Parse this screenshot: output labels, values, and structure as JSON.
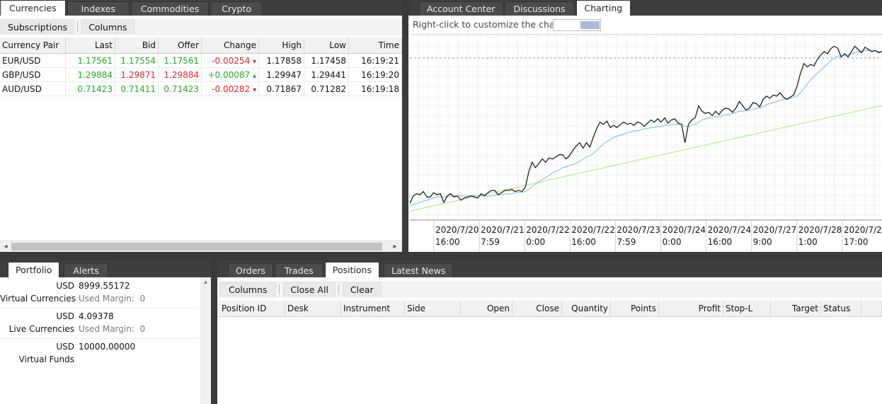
{
  "left_tabs": [
    "Currencies",
    "Indexes",
    "Commodities",
    "Crypto"
  ],
  "left_toolbar": {
    "subscriptions": "Subscriptions",
    "columns": "Columns"
  },
  "quotes": {
    "headers": [
      "Currency Pair",
      "Last",
      "Bid",
      "Offer",
      "Change",
      "High",
      "Low",
      "Time"
    ],
    "rows": [
      {
        "pair": "EUR/USD",
        "last": "1.17561",
        "bid": "1.17554",
        "offer": "1.17561",
        "change": "-0.00254",
        "dir": "▾",
        "high": "1.17858",
        "low": "1.17458",
        "time": "16:19:21"
      },
      {
        "pair": "GBP/USD",
        "last": "1.29884",
        "bid": "1.29871",
        "offer": "1.29884",
        "change": "+0.00087",
        "dir": "▴",
        "high": "1.29947",
        "low": "1.29441",
        "time": "16:19:20"
      },
      {
        "pair": "AUD/USD",
        "last": "0.71423",
        "bid": "0.71411",
        "offer": "0.71423",
        "change": "-0.00282",
        "dir": "▾",
        "high": "0.71867",
        "low": "0.71282",
        "time": "16:19:18"
      }
    ]
  },
  "right_tabs": [
    "Account Center",
    "Discussions",
    "Charting"
  ],
  "chart_hint": "Right-click to customize the chart",
  "chart_data": {
    "type": "line",
    "x_ticks": [
      {
        "date": "2020/7/20",
        "time": "16:00"
      },
      {
        "date": "2020/7/21",
        "time": "7:59"
      },
      {
        "date": "2020/7/22",
        "time": "0:00"
      },
      {
        "date": "2020/7/22",
        "time": "16:00"
      },
      {
        "date": "2020/7/23",
        "time": "7:59"
      },
      {
        "date": "2020/7/24",
        "time": "0:00"
      },
      {
        "date": "2020/7/24",
        "time": "16:00"
      },
      {
        "date": "2020/7/27",
        "time": "9:00"
      },
      {
        "date": "2020/7/28",
        "time": "1:00"
      },
      {
        "date": "2020/7/28",
        "time": "17:00"
      }
    ],
    "series": [
      {
        "color": "#111111",
        "values": [
          0.07,
          0.14,
          0.16,
          0.15,
          0.18,
          0.13,
          0.13,
          0.17,
          0.15,
          0.16,
          0.08,
          0.14,
          0.16,
          0.13,
          0.14,
          0.1,
          0.12,
          0.13,
          0.14,
          0.13,
          0.12,
          0.16,
          0.14,
          0.17,
          0.19,
          0.19,
          0.15,
          0.17,
          0.19,
          0.19,
          0.2,
          0.18,
          0.19,
          0.18,
          0.22,
          0.36,
          0.45,
          0.4,
          0.44,
          0.48,
          0.45,
          0.49,
          0.48,
          0.5,
          0.52,
          0.52,
          0.48,
          0.51,
          0.56,
          0.6,
          0.63,
          0.58,
          0.63,
          0.59,
          0.68,
          0.76,
          0.82,
          0.8,
          0.83,
          0.77,
          0.79,
          0.77,
          0.8,
          0.82,
          0.8,
          0.81,
          0.79,
          0.82,
          0.81,
          0.78,
          0.81,
          0.84,
          0.82,
          0.85,
          0.82,
          0.86,
          0.81,
          0.84,
          0.85,
          0.81,
          0.8,
          0.63,
          0.8,
          0.84,
          0.86,
          0.97,
          0.92,
          0.9,
          0.91,
          0.88,
          0.92,
          0.89,
          0.93,
          0.95,
          0.94,
          0.91,
          0.95,
          1.01,
          0.97,
          0.93,
          0.95,
          1.0,
          0.99,
          0.96,
          1.03,
          1.06,
          1.04,
          1.07,
          1.06,
          1.09,
          1.05,
          1.03,
          1.05,
          1.07,
          1.15,
          1.27,
          1.36,
          1.33,
          1.35,
          1.34,
          1.4,
          1.44,
          1.47,
          1.45,
          1.5,
          1.52,
          1.5,
          1.42,
          1.45,
          1.42,
          1.47,
          1.52,
          1.49,
          1.46,
          1.51,
          1.49,
          1.47,
          1.48,
          1.46,
          1.47
        ]
      },
      {
        "color": "#8fc3e8",
        "values": [
          0.05,
          0.06,
          0.07,
          0.08,
          0.09,
          0.1,
          0.11,
          0.12,
          0.13,
          0.13,
          0.13,
          0.13,
          0.14,
          0.14,
          0.14,
          0.14,
          0.14,
          0.14,
          0.14,
          0.14,
          0.14,
          0.14,
          0.14,
          0.14,
          0.14,
          0.15,
          0.15,
          0.15,
          0.16,
          0.16,
          0.16,
          0.17,
          0.17,
          0.17,
          0.18,
          0.2,
          0.23,
          0.25,
          0.27,
          0.29,
          0.31,
          0.33,
          0.35,
          0.37,
          0.38,
          0.4,
          0.41,
          0.42,
          0.43,
          0.44,
          0.46,
          0.48,
          0.5,
          0.51,
          0.53,
          0.56,
          0.59,
          0.62,
          0.64,
          0.66,
          0.68,
          0.69,
          0.7,
          0.71,
          0.72,
          0.73,
          0.74,
          0.74,
          0.75,
          0.76,
          0.76,
          0.77,
          0.77,
          0.78,
          0.78,
          0.79,
          0.79,
          0.8,
          0.8,
          0.8,
          0.8,
          0.78,
          0.78,
          0.79,
          0.8,
          0.82,
          0.84,
          0.85,
          0.86,
          0.86,
          0.87,
          0.87,
          0.88,
          0.89,
          0.89,
          0.9,
          0.91,
          0.92,
          0.92,
          0.93,
          0.93,
          0.94,
          0.95,
          0.95,
          0.96,
          0.98,
          0.99,
          1.0,
          1.01,
          1.02,
          1.03,
          1.03,
          1.04,
          1.05,
          1.06,
          1.09,
          1.13,
          1.17,
          1.21,
          1.24,
          1.27,
          1.3,
          1.33,
          1.36,
          1.39,
          1.41,
          1.43,
          1.43,
          1.44,
          1.44,
          1.45,
          1.46,
          1.47,
          1.47,
          1.48,
          1.48,
          1.48,
          1.48,
          1.47,
          1.47
        ]
      },
      {
        "color": "#b7e08c",
        "values": [
          0.0,
          0.007,
          0.014,
          0.021,
          0.028,
          0.035,
          0.042,
          0.049,
          0.056,
          0.063,
          0.07,
          0.077,
          0.084,
          0.091,
          0.098,
          0.105,
          0.112,
          0.119,
          0.126,
          0.133,
          0.14,
          0.147,
          0.154,
          0.161,
          0.168,
          0.175,
          0.182,
          0.189,
          0.196,
          0.203,
          0.21,
          0.217,
          0.224,
          0.231,
          0.238,
          0.245,
          0.252,
          0.259,
          0.266,
          0.273,
          0.28,
          0.287,
          0.294,
          0.301,
          0.308,
          0.315,
          0.322,
          0.329,
          0.336,
          0.343,
          0.35,
          0.357,
          0.364,
          0.371,
          0.378,
          0.385,
          0.392,
          0.399,
          0.406,
          0.413,
          0.42,
          0.427,
          0.434,
          0.441,
          0.448,
          0.455,
          0.462,
          0.469,
          0.476,
          0.483,
          0.49,
          0.497,
          0.504,
          0.511,
          0.518,
          0.525,
          0.532,
          0.539,
          0.546,
          0.553,
          0.56,
          0.567,
          0.574,
          0.581,
          0.588,
          0.595,
          0.602,
          0.609,
          0.616,
          0.623,
          0.63,
          0.637,
          0.644,
          0.651,
          0.658,
          0.665,
          0.672,
          0.679,
          0.686,
          0.693,
          0.7,
          0.707,
          0.714,
          0.721,
          0.728,
          0.735,
          0.742,
          0.749,
          0.756,
          0.763,
          0.77,
          0.777,
          0.784,
          0.791,
          0.798,
          0.805,
          0.812,
          0.819,
          0.826,
          0.833,
          0.84,
          0.847,
          0.854,
          0.861,
          0.868,
          0.875,
          0.882,
          0.889,
          0.896,
          0.903,
          0.91,
          0.917,
          0.924,
          0.931,
          0.938,
          0.945,
          0.952,
          0.959,
          0.966,
          0.973
        ]
      }
    ]
  },
  "portfolio_tabs": [
    "Portfolio",
    "Alerts"
  ],
  "portfolio": [
    {
      "currency": "USD",
      "amount": "8999.55172",
      "label": "Virtual Currencies",
      "margin": "Used Margin:  0"
    },
    {
      "currency": "USD",
      "amount": "4.09378",
      "label": "Live Currencies",
      "margin": "Used Margin:  0"
    },
    {
      "currency": "USD",
      "amount": "10000.00000",
      "label": "Virtual Funds",
      "margin": ""
    }
  ],
  "bottom_tabs": [
    "Orders",
    "Trades",
    "Positions",
    "Latest News"
  ],
  "positions_toolbar": {
    "columns": "Columns",
    "close_all": "Close All",
    "clear": "Clear"
  },
  "positions_headers": [
    "Position ID",
    "Desk",
    "Instrument",
    "Side",
    "Open",
    "Close",
    "Quantity",
    "Points",
    "Profit",
    "Stop-L",
    "Target",
    "Status"
  ]
}
